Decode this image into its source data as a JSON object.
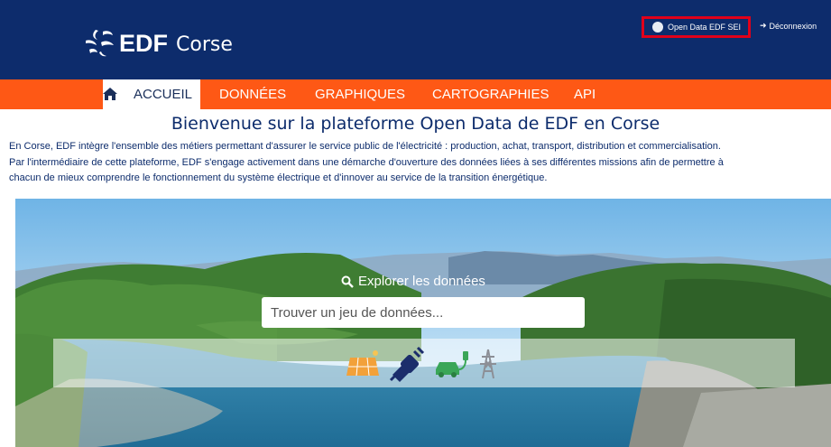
{
  "header": {
    "brand": "EDF",
    "region": "Corse",
    "user_label": "Open Data EDF SEI",
    "logout_label": "Déconnexion"
  },
  "nav": {
    "items": [
      {
        "label": "ACCUEIL",
        "active": true
      },
      {
        "label": "DONNÉES"
      },
      {
        "label": "GRAPHIQUES"
      },
      {
        "label": "CARTOGRAPHIES"
      },
      {
        "label": "API"
      }
    ]
  },
  "main": {
    "welcome": "Bienvenue sur la plateforme Open Data de EDF en Corse",
    "intro_line1": "En Corse, EDF intègre l'ensemble des métiers permettant d'assurer le service public de l'électricité : production, achat, transport, distribution et commercialisation.",
    "intro_line2": "Par l'intermédiaire de cette plateforme, EDF s'engage activement dans une démarche d'ouverture des données liées à ses différentes missions afin de permettre à",
    "intro_line3": "chacun de mieux comprendre le fonctionnement du système électrique et d'innover au service de la transition énergétique."
  },
  "hero": {
    "explore_label": "Explorer les données",
    "search_placeholder": "Trouver un jeu de données...",
    "categories": [
      "solar-panel-icon",
      "plug-icon",
      "electric-car-icon",
      "pylon-icon"
    ]
  },
  "colors": {
    "header_bg": "#0d2c6c",
    "nav_bg": "#fe5815",
    "text_blue": "#0d2c6c",
    "highlight": "#e0001a"
  }
}
